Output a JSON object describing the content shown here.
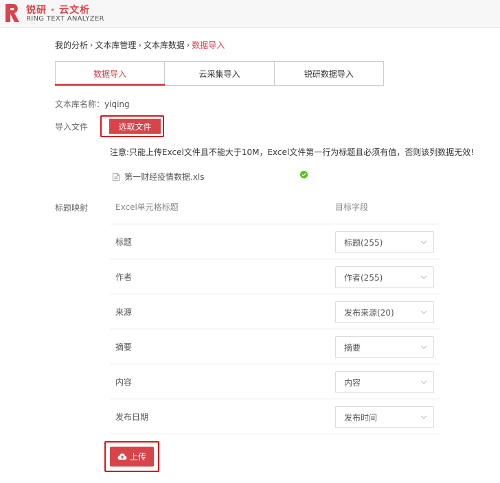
{
  "brand": {
    "name_cn": "锐研 · 云文析",
    "name_en": "RING TEXT ANALYZER",
    "color": "#d9434a",
    "logo_icon": "ring-r-logo-icon"
  },
  "breadcrumb": {
    "items": [
      "我的分析",
      "文本库管理",
      "文本库数据"
    ],
    "current": "数据导入",
    "separator": "›"
  },
  "tabs": [
    {
      "label": "数据导入",
      "active": true
    },
    {
      "label": "云采集导入",
      "active": false
    },
    {
      "label": "锐研数据导入",
      "active": false
    }
  ],
  "library": {
    "label": "文本库名称：",
    "value": "yiqing"
  },
  "import_file": {
    "label": "导入文件",
    "choose_button": "选取文件"
  },
  "notice": "注意:只能上传Excel文件且不能大于10M，Excel文件第一行为标题且必须有值，否则该列数据无效!",
  "selected_file": {
    "icon": "document-icon",
    "name": "第一财经疫情数据.xls",
    "status_icon": "check-circle-icon",
    "status_color": "#52c41a"
  },
  "mapping": {
    "label": "标题映射",
    "header_source": "Excel单元格标题",
    "header_target": "目标字段",
    "rows": [
      {
        "source": "标题",
        "target": "标题(255)"
      },
      {
        "source": "作者",
        "target": "作者(255)"
      },
      {
        "source": "来源",
        "target": "发布来源(20)"
      },
      {
        "source": "摘要",
        "target": "摘要"
      },
      {
        "source": "内容",
        "target": "内容"
      },
      {
        "source": "发布日期",
        "target": "发布时间"
      }
    ]
  },
  "upload_button": {
    "label": "上传",
    "icon": "cloud-upload-icon"
  }
}
